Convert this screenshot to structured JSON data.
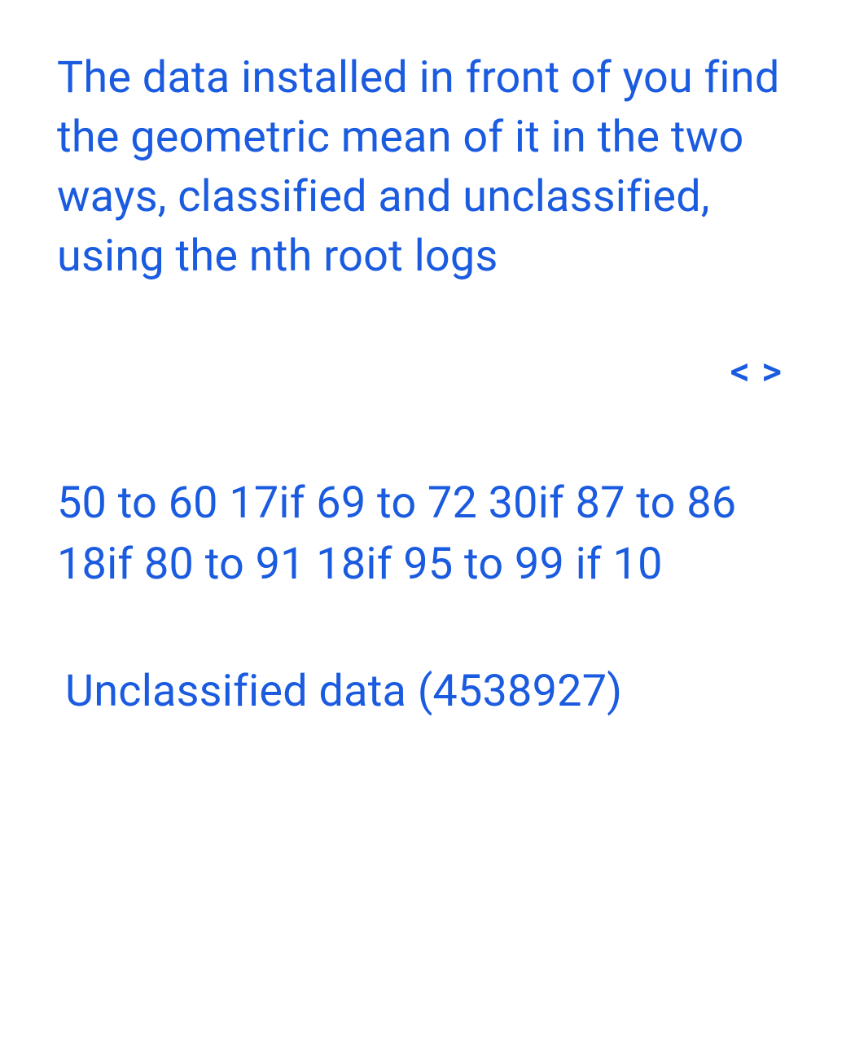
{
  "intro": "The data installed in front of you find the geometric mean of it in the two ways, classified and unclassified, using the nth root logs",
  "nav": {
    "prev": "<",
    "next": ">"
  },
  "classified_text": " 50 to 60 17if 69 to 72 30if 87 to 86 18if 80 to 91 18if 95 to 99 if 10",
  "unclassified_text": "Unclassified data (4538927)"
}
